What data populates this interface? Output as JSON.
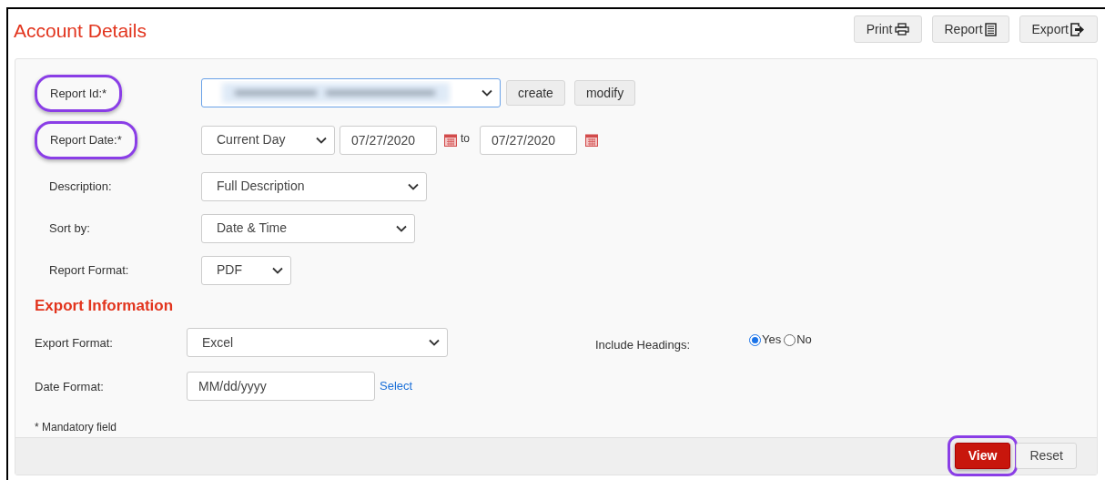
{
  "title": "Account Details",
  "toolbar": [
    {
      "label": "Print"
    },
    {
      "label": "Report"
    },
    {
      "label": "Export"
    }
  ],
  "rows": [
    {
      "kind": "select",
      "label": "Report Id:*",
      "highlighted": true,
      "value_blurred": true,
      "buttons": [
        "create",
        "modify"
      ]
    },
    {
      "kind": "date-range",
      "label": "Report Date:*",
      "highlighted": true,
      "value": "Current Day",
      "from": "07/27/2020",
      "separator": "to",
      "to": "07/27/2020"
    },
    {
      "kind": "select",
      "label": "Description:",
      "highlighted": false,
      "value": "Full Description"
    },
    {
      "kind": "select",
      "label": "Sort by:",
      "highlighted": false,
      "value": "Date & Time"
    },
    {
      "kind": "select",
      "label": "Report Format:",
      "highlighted": false,
      "value": "PDF"
    }
  ],
  "section_heading": "Export Information",
  "export_rows": [
    {
      "kind": "select",
      "label": "Export Format:",
      "value": "Excel",
      "side": {
        "label": "Include Headings:",
        "options": [
          {
            "label": "Yes",
            "selected": true
          },
          {
            "label": "No",
            "selected": false
          }
        ]
      }
    },
    {
      "kind": "text",
      "label": "Date Format:",
      "value": "MM/dd/yyyy",
      "link": "Select"
    }
  ],
  "note": "* Mandatory field",
  "footer_buttons": [
    {
      "label": "View",
      "primary": true,
      "highlighted": true
    },
    {
      "label": "Reset",
      "primary": false,
      "highlighted": false
    }
  ]
}
